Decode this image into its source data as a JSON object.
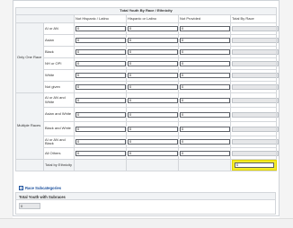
{
  "table": {
    "title": "Total Youth By Race / Ethnicity",
    "columns": [
      "Not Hispanic / Latino",
      "Hispanic or Latino",
      "Not Provided",
      "Total By Race"
    ],
    "groups": [
      {
        "label": "Only One Race",
        "rows": [
          {
            "label": "AI or AN",
            "values": [
              "0",
              "0",
              "0",
              ""
            ]
          },
          {
            "label": "Asian",
            "values": [
              "0",
              "0",
              "0",
              ""
            ]
          },
          {
            "label": "Black",
            "values": [
              "0",
              "0",
              "0",
              ""
            ]
          },
          {
            "label": "NH or OPI",
            "values": [
              "0",
              "0",
              "0",
              ""
            ]
          },
          {
            "label": "White",
            "values": [
              "0",
              "0",
              "0",
              ""
            ]
          },
          {
            "label": "Not given",
            "values": [
              "0",
              "0",
              "0",
              ""
            ]
          }
        ]
      },
      {
        "label": "Multiple Races",
        "rows": [
          {
            "label": "AI or AN and White",
            "values": [
              "0",
              "0",
              "0",
              ""
            ]
          },
          {
            "label": "Asian and White",
            "values": [
              "0",
              "0",
              "0",
              ""
            ]
          },
          {
            "label": "Black and White",
            "values": [
              "0",
              "0",
              "0",
              ""
            ]
          },
          {
            "label": "AI or AN and Black",
            "values": [
              "0",
              "0",
              "0",
              ""
            ]
          },
          {
            "label": "All Others",
            "values": [
              "0",
              "0",
              "0",
              ""
            ]
          }
        ]
      }
    ],
    "total_row": {
      "label": "Total by Ethnicity",
      "values": [
        "",
        "",
        "",
        "0"
      ]
    }
  },
  "subcategories_link": "Race Subcategories",
  "subpanel": {
    "title": "Total Youth with Subraces",
    "value": "0"
  },
  "colors": {
    "highlight": "#f2ea2e",
    "link": "#1a4f9c"
  }
}
